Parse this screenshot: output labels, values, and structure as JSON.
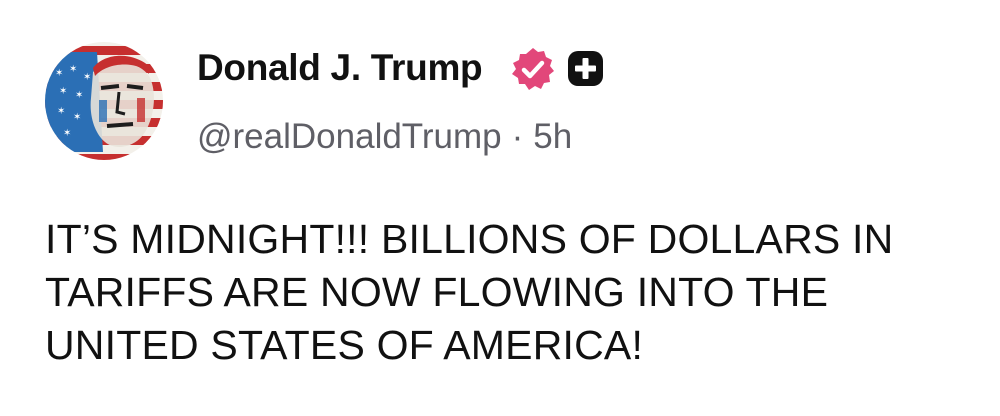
{
  "post": {
    "author_name": "Donald J. Trump",
    "handle": "@realDonaldTrump",
    "separator": "·",
    "timestamp": "5h",
    "text": "IT’S MIDNIGHT!!! BILLIONS OF DOLLARS IN TARIFFS ARE NOW FLOWING INTO THE UNITED STATES OF AMERICA!"
  },
  "icons": {
    "verified": "verified-badge-icon",
    "plus": "plus-badge-icon",
    "avatar": "avatar-flag-portrait"
  },
  "colors": {
    "verified_badge": "#e2477a",
    "plus_badge": "#111111",
    "handle_text": "#5f5f66",
    "body_text": "#111111",
    "flag_red": "#c62f2f",
    "flag_blue": "#2b6fb5"
  }
}
